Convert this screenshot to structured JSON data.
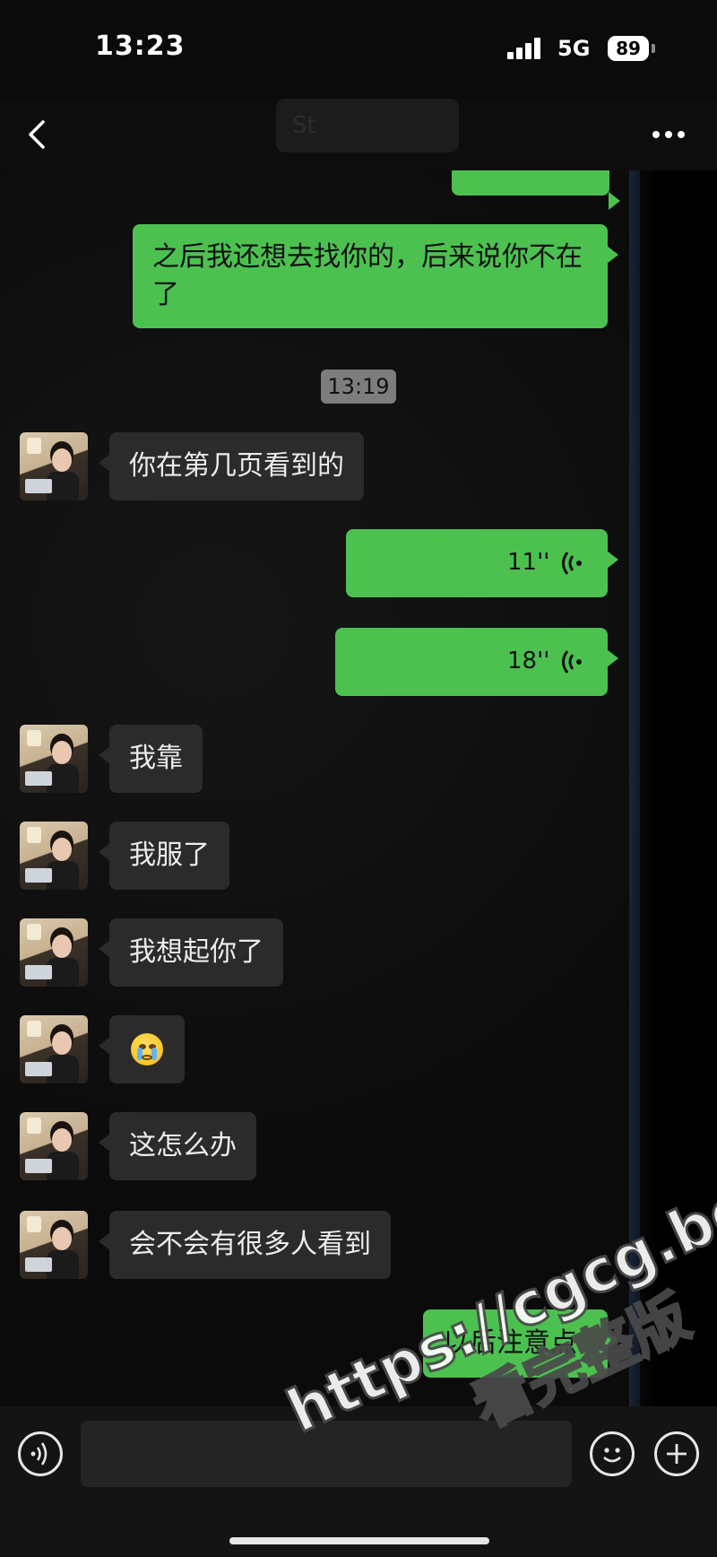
{
  "status_bar": {
    "time": "13:23",
    "network": "5G",
    "battery": "89"
  },
  "nav": {
    "title": "St"
  },
  "messages": {
    "m1": {
      "text": "之后我还想去找你的，后来说你不在了"
    },
    "timestamp": "13:19",
    "m2": {
      "text": "你在第几页看到的"
    },
    "m3": {
      "duration": "11''"
    },
    "m4": {
      "duration": "18''"
    },
    "m5": {
      "text": "我靠"
    },
    "m6": {
      "text": "我服了"
    },
    "m7": {
      "text": "我想起你了"
    },
    "m8": {
      "emoji": "crying-face-emoji"
    },
    "m9": {
      "text": "这怎么办"
    },
    "m10": {
      "text": "会不会有很多人看到"
    },
    "m11": {
      "text": "以后注意点"
    }
  },
  "watermark": {
    "url": "https://cgcg.bet",
    "text": "看完整版"
  },
  "colors": {
    "outgoing_bubble": "#4cc150",
    "incoming_bubble": "#2b2b2b",
    "background": "#0b0b0b"
  }
}
